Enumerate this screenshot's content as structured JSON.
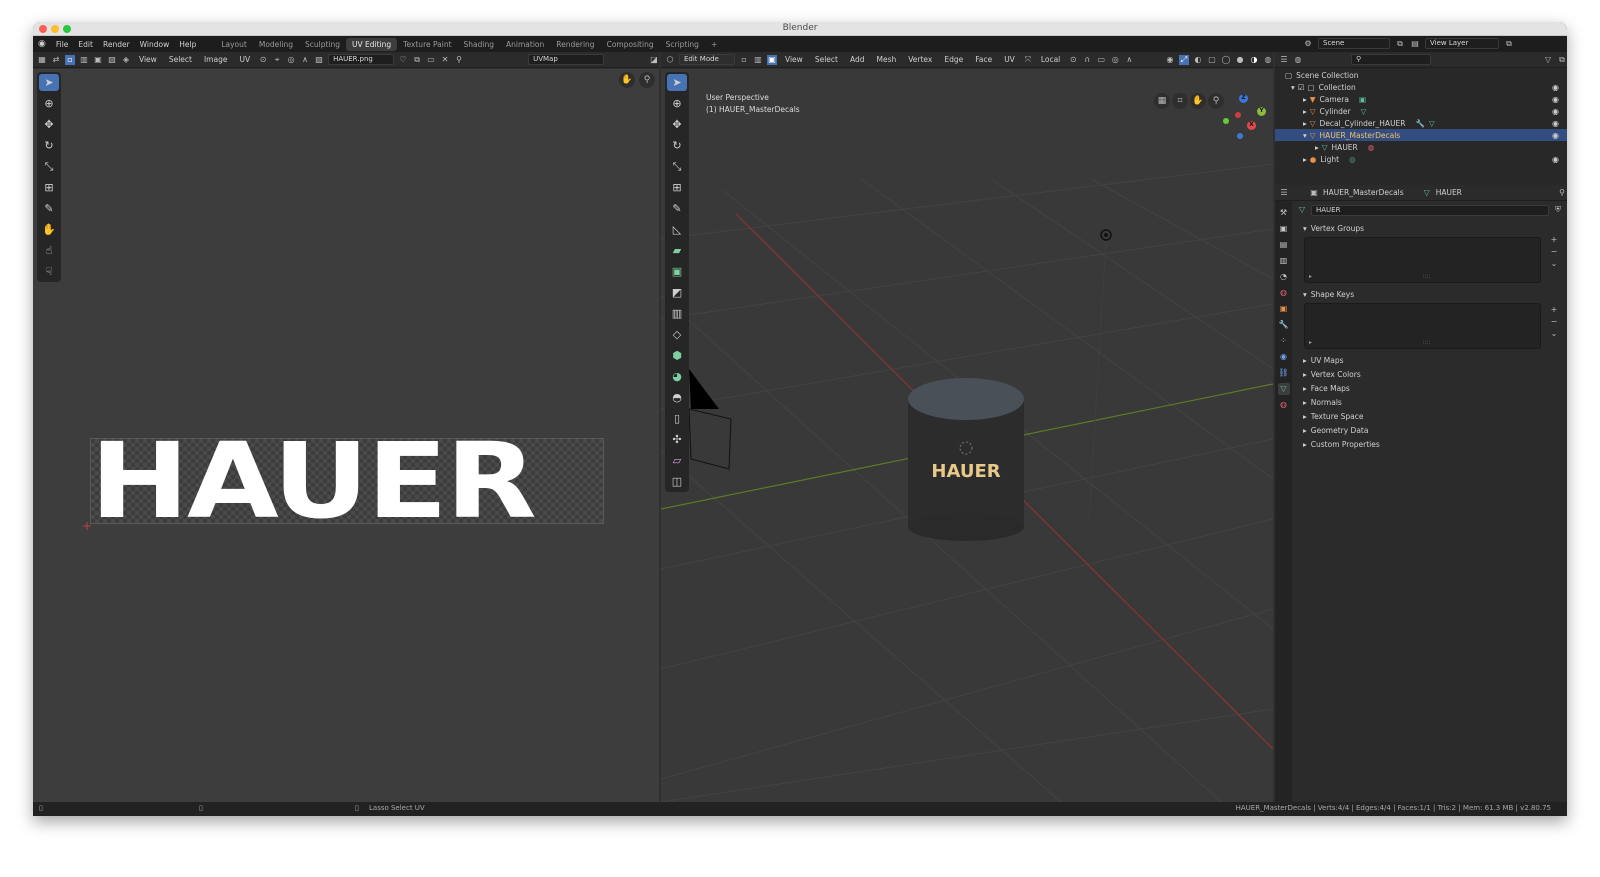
{
  "window": {
    "title": "Blender"
  },
  "menu": [
    "File",
    "Edit",
    "Render",
    "Window",
    "Help"
  ],
  "workspaces": [
    "Layout",
    "Modeling",
    "Sculpting",
    "UV Editing",
    "Texture Paint",
    "Shading",
    "Animation",
    "Rendering",
    "Compositing",
    "Scripting"
  ],
  "active_workspace": "UV Editing",
  "uv_editor": {
    "menus": [
      "View",
      "Select",
      "Image",
      "UV"
    ],
    "image_name": "HAUER.png",
    "uv_map": "UVMap",
    "image_text": "HAUER"
  },
  "viewport": {
    "mode": "Edit Mode",
    "menus": [
      "View",
      "Select",
      "Add",
      "Mesh",
      "Vertex",
      "Edge",
      "Face",
      "UV"
    ],
    "transform_orientation": "Local",
    "overlay_line1": "User Perspective",
    "overlay_line2": "(1) HAUER_MasterDecals",
    "decal_text": "HAUER",
    "gizmo_axes": {
      "x": "X",
      "y": "Y",
      "z": "Z"
    }
  },
  "topright": {
    "scene": "Scene",
    "view_layer": "View Layer"
  },
  "outliner": {
    "root": "Scene Collection",
    "items": [
      {
        "label": "Collection"
      },
      {
        "label": "Camera"
      },
      {
        "label": "Cylinder"
      },
      {
        "label": "Decal_Cylinder_HAUER"
      },
      {
        "label": "HAUER_MasterDecals"
      },
      {
        "label": "HAUER"
      },
      {
        "label": "Light"
      }
    ]
  },
  "properties": {
    "object": "HAUER_MasterDecals",
    "data": "HAUER",
    "data_field": "HAUER",
    "panels_open": [
      "Vertex Groups",
      "Shape Keys"
    ],
    "panels_closed": [
      "UV Maps",
      "Vertex Colors",
      "Face Maps",
      "Normals",
      "Texture Space",
      "Geometry Data",
      "Custom Properties"
    ]
  },
  "statusbar": {
    "hint": "Lasso Select UV",
    "stats": "HAUER_MasterDecals  |  Verts:4/4 | Edges:4/4 | Faces:1/1 | Tris:2 | Mem: 61.3 MB | v2.80.75"
  },
  "colors": {
    "accent": "#4772b3",
    "highlight_row": "#334d80",
    "x_axis": "#b83a3a",
    "y_axis": "#7a9a2e"
  }
}
